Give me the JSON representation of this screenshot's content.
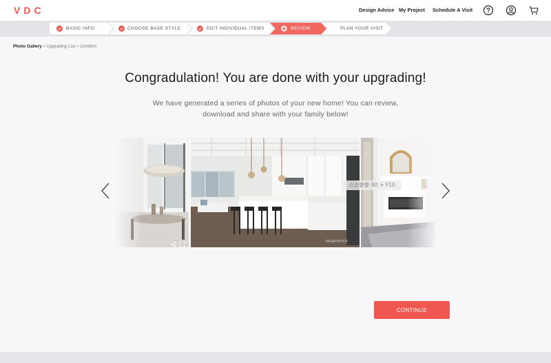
{
  "brand": {
    "logo": "VDC",
    "accent_color": "#f0574f"
  },
  "nav": {
    "links": [
      "Design Advice",
      "My Project",
      "Schedule A Visit"
    ],
    "icons": [
      "help-circle-icon",
      "user-circle-icon",
      "cart-icon"
    ]
  },
  "steps": [
    {
      "label": "BASIC INFO",
      "state": "done"
    },
    {
      "label": "CHOOSE BASE STYLE",
      "state": "done"
    },
    {
      "label": "EDIT INDIVIDUAL ITEMS",
      "state": "done"
    },
    {
      "label": "REVIEW",
      "state": "active"
    },
    {
      "label": "PLAN YOUR VISIT",
      "state": "todo"
    }
  ],
  "breadcrumb": {
    "items": [
      "Photo Gallery",
      "Upgrading List",
      "Comfirm"
    ],
    "separator": ">"
  },
  "main": {
    "headline": "Congradulation! You are done with your upgrading!",
    "subtext": "We have generated a series of photos of your new home! You can review, download and share with your family below!"
  },
  "carousel": {
    "overlay_text": "点击录像 Alt + F10",
    "watermark": "©KAPHOTO",
    "photos": [
      "dining-room-photo",
      "kitchen-photo",
      "living-room-photo"
    ]
  },
  "actions": {
    "continue_label": "CONTINUE"
  }
}
